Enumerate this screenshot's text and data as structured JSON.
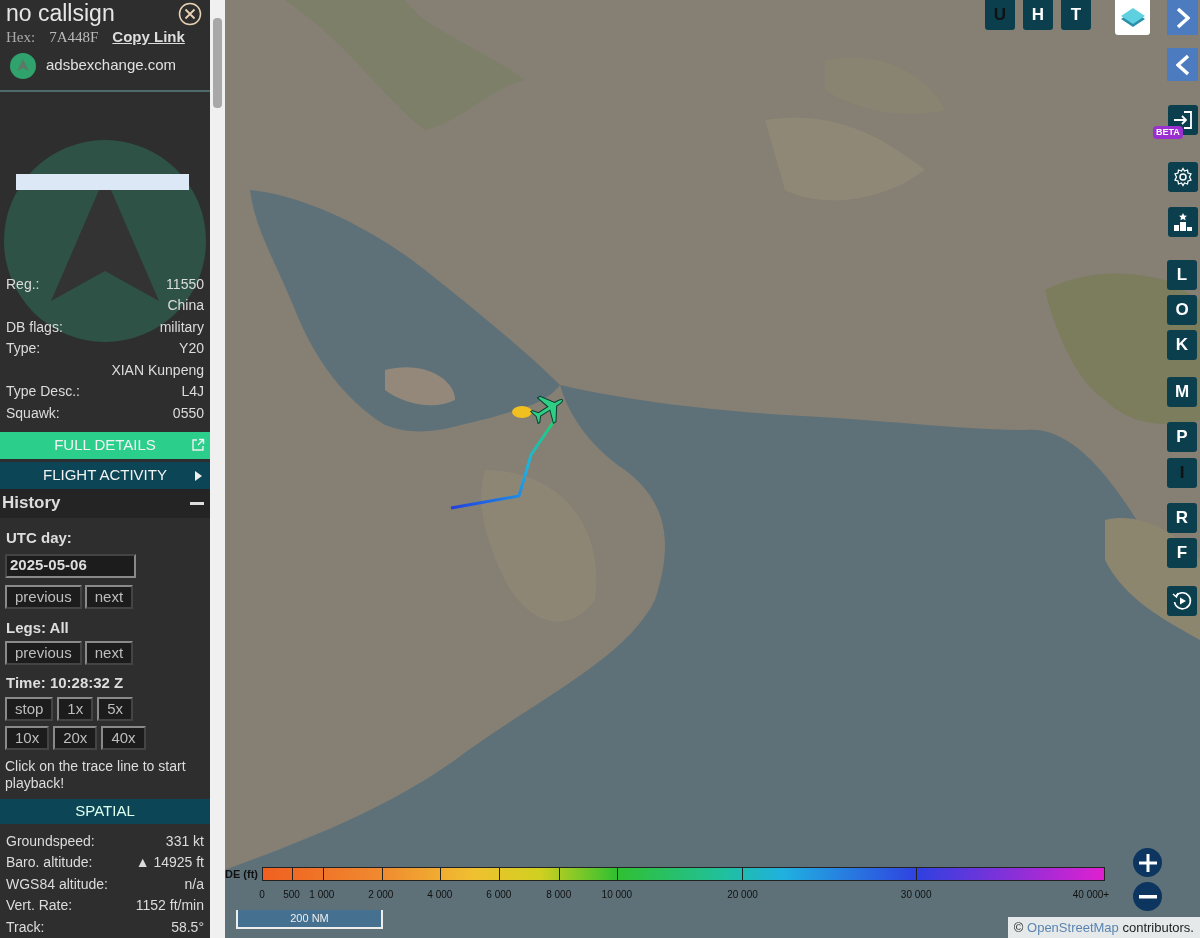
{
  "sidebar": {
    "title": "no callsign",
    "hex_label": "Hex:",
    "hex": "7A448F",
    "copy_link": "Copy Link",
    "site": "adsbexchange.com",
    "info": [
      {
        "label": "Reg.:",
        "value": "11550"
      },
      {
        "value": "China"
      },
      {
        "label": "DB flags:",
        "value": "military"
      },
      {
        "label": "Type:",
        "value": "Y20"
      },
      {
        "value": "XIAN Kunpeng"
      },
      {
        "label": "Type Desc.:",
        "value": "L4J"
      },
      {
        "label": "Squawk:",
        "value": "0550"
      }
    ],
    "full_details": "FULL DETAILS",
    "flight_activity": "FLIGHT ACTIVITY",
    "history": {
      "title": "History",
      "expanded": true,
      "utc_day_label": "UTC day:",
      "date": "2025-05-06",
      "day_buttons": [
        "previous",
        "next"
      ],
      "legs_label": "Legs: All",
      "leg_buttons": [
        "previous",
        "next"
      ],
      "time": "Time: 10:28:32 Z",
      "speed_rows": [
        [
          "stop",
          "1x",
          "5x"
        ],
        [
          "10x",
          "20x",
          "40x"
        ]
      ],
      "hint": "Click on the trace line to start playback!"
    },
    "spatial": {
      "title": "SPATIAL",
      "rows": [
        {
          "label": "Groundspeed:",
          "value": "331 kt"
        },
        {
          "label": "Baro. altitude:",
          "value": "▲ 14925 ft"
        },
        {
          "label": "WGS84 altitude:",
          "value": "n/a"
        },
        {
          "label": "Vert. Rate:",
          "value": "1152 ft/min"
        },
        {
          "label": "Track:",
          "value": "58.5°"
        }
      ]
    }
  },
  "map": {
    "top_buttons": [
      {
        "label": "U",
        "active": false
      },
      {
        "label": "H",
        "active": true
      },
      {
        "label": "T",
        "active": true
      }
    ],
    "beta_badge": "BETA",
    "side_buttons": [
      {
        "label": "L",
        "active": true
      },
      {
        "label": "O",
        "active": true
      },
      {
        "label": "K",
        "active": true
      },
      {
        "label": "M",
        "active": true
      },
      {
        "label": "P",
        "active": true
      },
      {
        "label": "I",
        "active": false
      },
      {
        "label": "R",
        "active": true
      },
      {
        "label": "F",
        "active": true
      }
    ],
    "legend": {
      "label": "DE (ft)",
      "ticks": [
        "0",
        "500",
        "1 000",
        "2 000",
        "4 000",
        "6 000",
        "8 000",
        "10 000",
        "20 000",
        "30 000",
        "40 000+"
      ]
    },
    "scale": "200 NM",
    "attribution": {
      "prefix": "©",
      "link": "OpenStreetMap",
      "suffix": "contributors."
    }
  }
}
